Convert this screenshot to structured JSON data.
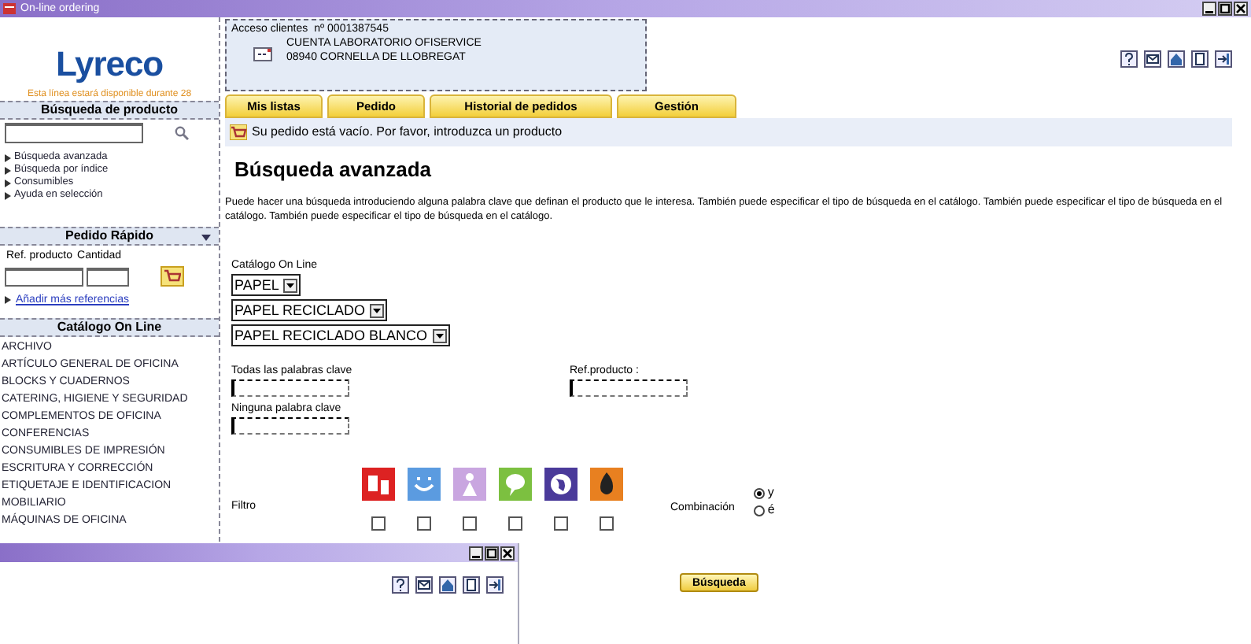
{
  "window": {
    "title": "On-line ordering"
  },
  "logo": {
    "text": "Lyreco",
    "tagline": "Esta línea estará disponible durante 28"
  },
  "account": {
    "label": "Acceso clientes",
    "number": "nº 0001387545",
    "name": "CUENTA LABORATORIO OFISERVICE",
    "address": "08940 CORNELLA DE LLOBREGAT"
  },
  "sidebar": {
    "product_search": {
      "title": "Búsqueda de producto",
      "links": [
        "Búsqueda avanzada",
        "Búsqueda por índice",
        "Consumibles",
        "Ayuda en selección"
      ]
    },
    "quick_order": {
      "title": "Pedido Rápido",
      "ref_label": "Ref. producto",
      "qty_label": "Cantidad",
      "link": "Añadir más referencias"
    },
    "catalog": {
      "title": "Catálogo On Line",
      "items": [
        "ARCHIVO",
        "ARTÍCULO GENERAL DE OFICINA",
        "BLOCKS Y CUADERNOS",
        "CATERING, HIGIENE Y SEGURIDAD",
        "COMPLEMENTOS DE OFICINA",
        "CONFERENCIAS",
        "CONSUMIBLES DE IMPRESIÓN",
        "ESCRITURA Y CORRECCIÓN",
        "ETIQUETAJE E IDENTIFICACION",
        "MOBILIARIO",
        "MÁQUINAS DE OFICINA"
      ]
    }
  },
  "tabs": [
    {
      "label": "Mis listas"
    },
    {
      "label": "Pedido"
    },
    {
      "label": "Historial de pedidos"
    },
    {
      "label": "Gestión"
    }
  ],
  "message": "Su pedido está vacío. Por favor, introduzca un producto",
  "heading": "Búsqueda avanzada",
  "intro": "Puede hacer una búsqueda introduciendo alguna palabra clave que definan el producto que le interesa. También puede especificar el tipo de búsqueda en el catálogo. También puede especificar el tipo de búsqueda en el catálogo. También puede especificar el tipo de búsqueda en el catálogo.",
  "form": {
    "catalog_label": "Catálogo On Line",
    "selects": [
      "PAPEL",
      "PAPEL RECICLADO",
      "PAPEL RECICLADO BLANCO"
    ],
    "all_words_label": "Todas las palabras clave",
    "ref_label": "Ref.producto :",
    "none_words_label": "Ninguna palabra clave",
    "filter_label": "Filtro",
    "filters": [
      {
        "color": "#dd2222",
        "checked": false
      },
      {
        "color": "#5b9be0",
        "checked": false
      },
      {
        "color": "#c9a6e0",
        "checked": false
      },
      {
        "color": "#7cc040",
        "checked": false
      },
      {
        "color": "#4a3a9a",
        "checked": false
      },
      {
        "color": "#e88020",
        "checked": false
      }
    ],
    "combination_label": "Combinación",
    "combination": [
      {
        "label": "y",
        "selected": true
      },
      {
        "label": "é",
        "selected": false
      }
    ],
    "submit": "Búsqueda"
  }
}
